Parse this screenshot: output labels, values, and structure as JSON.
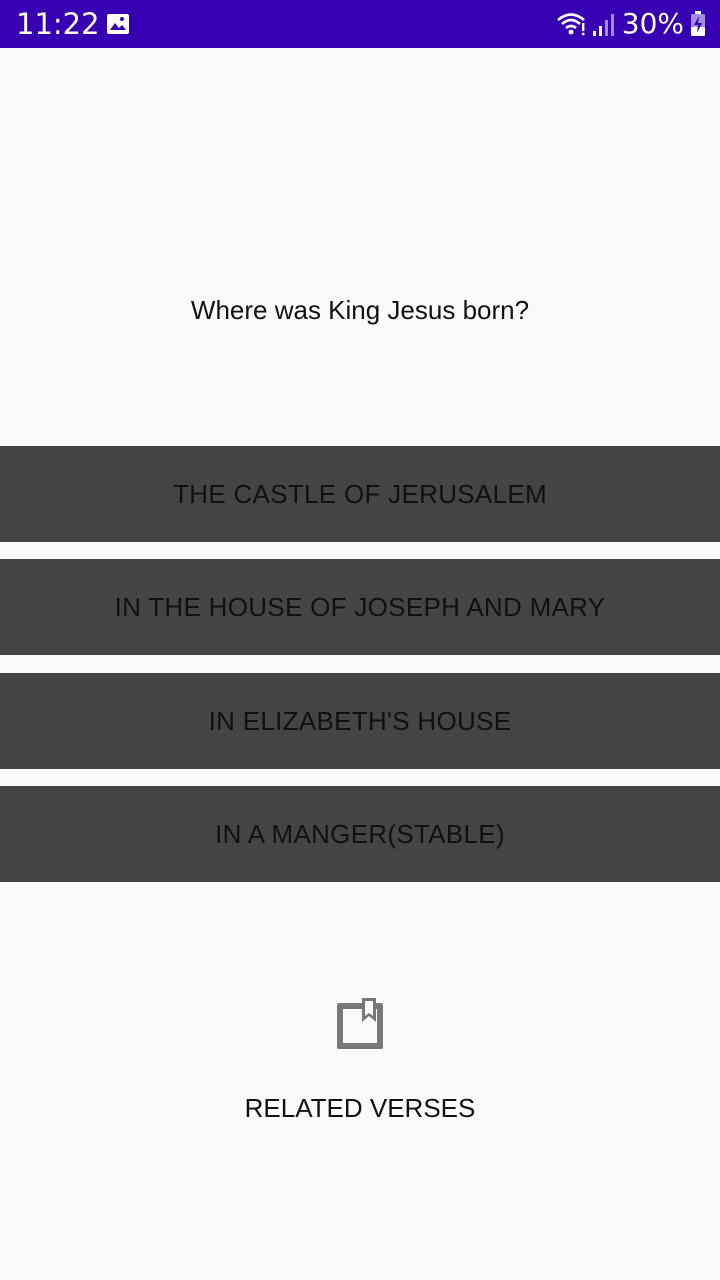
{
  "status_bar": {
    "time": "11:22",
    "battery": "30%",
    "icons": [
      "gallery-icon",
      "wifi-icon",
      "signal-icon",
      "battery-charging-icon"
    ],
    "background": "#3700b3"
  },
  "quiz": {
    "question": "Where was King Jesus born?",
    "answers": [
      "THE CASTLE OF JERUSALEM",
      "IN THE HOUSE OF JOSEPH AND MARY",
      "IN ELIZABETH'S HOUSE",
      "IN A MANGER(STABLE)"
    ],
    "answer_background": "#444444"
  },
  "related": {
    "label": "RELATED VERSES",
    "icon": "bookmark-icon"
  }
}
